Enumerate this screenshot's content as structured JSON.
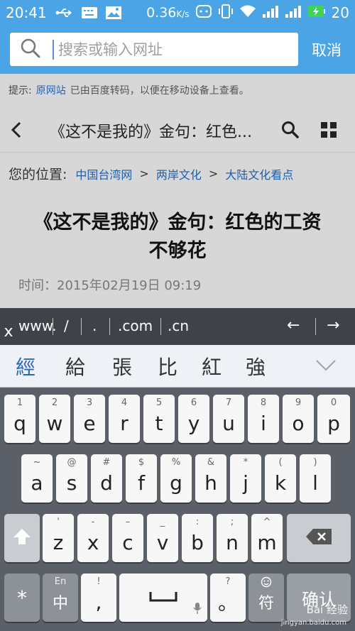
{
  "status": {
    "time": "20:41",
    "speed": "0.36",
    "speed_unit": "K/s",
    "battery": "20"
  },
  "search": {
    "placeholder": "搜索或输入网址",
    "cancel_label": "取消"
  },
  "tip": {
    "prefix": "提示:",
    "link": "原网站",
    "text": "已由百度转码，以便在移动设备上查看。"
  },
  "nav": {
    "title": "《这不是我的》金句：红色..."
  },
  "breadcrumb": {
    "label": "您的位置:",
    "items": [
      "中国台湾网",
      "两岸文化",
      "大陆文化看点"
    ],
    "separator": ">"
  },
  "article": {
    "title_line1": "《这不是我的》金句：红色的工资",
    "title_line2": "不够花",
    "meta": "时间：2015年02月19日 09:19"
  },
  "urlbar": {
    "close": "x",
    "chips": [
      "www.",
      "/",
      ".",
      ".com",
      ".cn"
    ],
    "left_arrow": "←",
    "right_arrow": "→"
  },
  "candidates": [
    "經",
    "給",
    "張",
    "比",
    "紅",
    "強"
  ],
  "keyboard": {
    "row1": [
      {
        "sub": "1",
        "main": "q"
      },
      {
        "sub": "2",
        "main": "w"
      },
      {
        "sub": "3",
        "main": "e"
      },
      {
        "sub": "4",
        "main": "r"
      },
      {
        "sub": "5",
        "main": "t"
      },
      {
        "sub": "6",
        "main": "y"
      },
      {
        "sub": "7",
        "main": "u"
      },
      {
        "sub": "8",
        "main": "i"
      },
      {
        "sub": "9",
        "main": "o"
      },
      {
        "sub": "0",
        "main": "p"
      }
    ],
    "row2": [
      {
        "sub": "~",
        "main": "a"
      },
      {
        "sub": "@",
        "main": "s"
      },
      {
        "sub": "#",
        "main": "d"
      },
      {
        "sub": "$",
        "main": "f"
      },
      {
        "sub": "%",
        "main": "g"
      },
      {
        "sub": "&",
        "main": "h"
      },
      {
        "sub": "*",
        "main": "j"
      },
      {
        "sub": "(",
        "main": "k"
      },
      {
        "sub": ")",
        "main": "l"
      }
    ],
    "row3": [
      {
        "sub": "'",
        "main": "z"
      },
      {
        "sub": "-",
        "main": "x"
      },
      {
        "sub": "–",
        "main": "c"
      },
      {
        "sub": "_",
        "main": "v"
      },
      {
        "sub": ":",
        "main": "b"
      },
      {
        "sub": ";",
        "main": "n"
      },
      {
        "sub": "^",
        "main": "m"
      }
    ],
    "row4": {
      "symbol": "*",
      "lang_sub": "En",
      "lang_main": "中",
      "comma_sub": "!",
      "comma_main": ",",
      "period_sub": "?",
      "period_main": "。",
      "symbols_label": "符",
      "enter_label": "确认"
    }
  },
  "watermark": {
    "brand": "Bai 经验",
    "domain": "jingyan.baidu.com"
  }
}
